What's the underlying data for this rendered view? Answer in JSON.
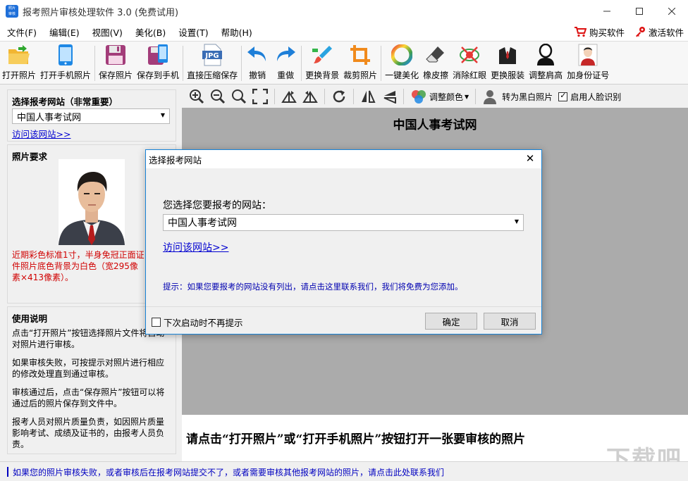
{
  "window": {
    "title": "报考照片审核处理软件 3.0 (免费试用)",
    "app_icon_text": "照片审核"
  },
  "menu": {
    "items": [
      "文件(F)",
      "编辑(E)",
      "视图(V)",
      "美化(B)",
      "设置(T)",
      "帮助(H)"
    ],
    "buy": "购买软件",
    "activate": "激活软件"
  },
  "toolbar": {
    "items": [
      "打开照片",
      "打开手机照片",
      "保存照片",
      "保存到手机",
      "直接压缩保存",
      "撤销",
      "重做",
      "更换背景",
      "裁剪照片",
      "一键美化",
      "橡皮擦",
      "消除红眼",
      "更换服装",
      "调整肩高",
      "加身份证号"
    ],
    "jpg_label": "JPG"
  },
  "left": {
    "site_title": "选择报考网站（非常重要）",
    "site_value": "中国人事考试网",
    "visit_link": "访问该网站>>",
    "req_title": "照片要求",
    "req_text": "近期彩色标准1寸，半身免冠正面证件照片底色背景为白色（宽295像素×413像素）。",
    "usage_title": "使用说明",
    "usage_paras": [
      "点击“打开照片”按钮选择照片文件将自动对照片进行审核。",
      "如果审核失败，可按提示对照片进行相应的修改处理直到通过审核。",
      "审核通过后，点击“保存照片”按钮可以将通过后的照片保存到文件中。",
      "报考人员对照片质量负责，如因照片质量影响考试、成绩及证书的，由报考人员负责。"
    ]
  },
  "imgtools": {
    "adjust_color": "调整颜色",
    "to_bw": "转为黑白照片",
    "face_detect": "启用人脸识别",
    "face_detect_checked": true
  },
  "canvas": {
    "title": "中国人事考试网",
    "hint": "请点击“打开照片”或“打开手机照片”按钮打开一张要审核的照片",
    "watermark": "下载吧"
  },
  "status": {
    "text": "如果您的照片审核失败，或者审核后在报考网站提交不了，或者需要审核其他报考网站的照片，请点击此处联系我们"
  },
  "dialog": {
    "title": "选择报考网站",
    "prompt": "您选择您要报考的网站：",
    "site_value": "中国人事考试网",
    "visit_link": "访问该网站>>",
    "tip": "提示：如果您要报考的网站没有列出，请点击这里联系我们，我们将免费为您添加。",
    "no_prompt": "下次启动时不再提示",
    "ok": "确定",
    "cancel": "取消"
  },
  "colors": {
    "accent": "#1883d7",
    "link": "#0000d0",
    "warning_text": "#d00000",
    "canvas_bg": "#ababab"
  }
}
